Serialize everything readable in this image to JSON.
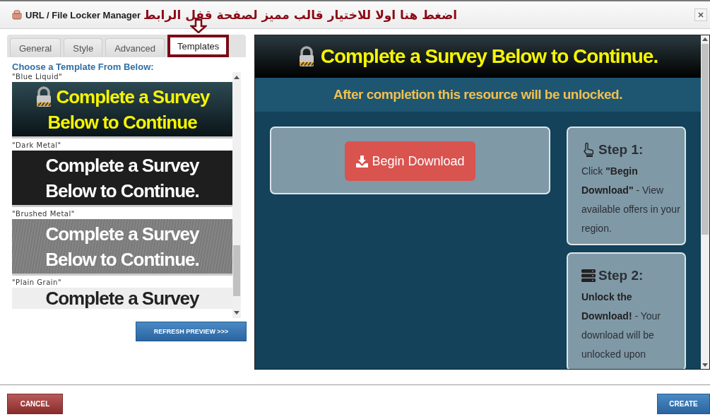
{
  "window": {
    "title": "URL / File Locker Manager"
  },
  "annotation": {
    "text": "اضغط هنا اولا للاختيار قالب مميز لصفحة قفل الرابط"
  },
  "tabs": [
    {
      "label": "General",
      "selected": false,
      "highlighted": false
    },
    {
      "label": "Style",
      "selected": false,
      "highlighted": false
    },
    {
      "label": "Advanced",
      "selected": false,
      "highlighted": false
    },
    {
      "label": "Templates",
      "selected": true,
      "highlighted": true
    }
  ],
  "templates": {
    "heading": "Choose a Template From Below:",
    "items": [
      {
        "name": "\"Blue Liquid\"",
        "kind": "liquid",
        "lines": [
          "Complete a Survey",
          "Below to Continue"
        ]
      },
      {
        "name": "\"Dark Metal\"",
        "kind": "dark",
        "lines": [
          "Complete a Survey",
          "Below to Continue."
        ]
      },
      {
        "name": "\"Brushed Metal\"",
        "kind": "brushed",
        "lines": [
          "Complete a Survey",
          "Below to Continue."
        ]
      },
      {
        "name": "\"Plain Grain\"",
        "kind": "grain",
        "lines": [
          "Complete a Survey"
        ]
      }
    ]
  },
  "refresh_button": "REFRESH PREVIEW >>>",
  "preview": {
    "title": "Complete a Survey Below to Continue.",
    "subtitle": "After completion this resource will be unlocked.",
    "download_button": "Begin Download",
    "steps": [
      {
        "kind": "click",
        "title": "Step 1:",
        "text": "Click **\"Begin Download\"** - View available offers in your region."
      },
      {
        "kind": "unlock",
        "title": "Step 2:",
        "text": "**Unlock the Download!** - Your download will be unlocked upon"
      }
    ]
  },
  "buttons": [
    {
      "label": "CANCEL",
      "kind": "cancel"
    },
    {
      "label": "CREATE",
      "kind": "create"
    }
  ]
}
